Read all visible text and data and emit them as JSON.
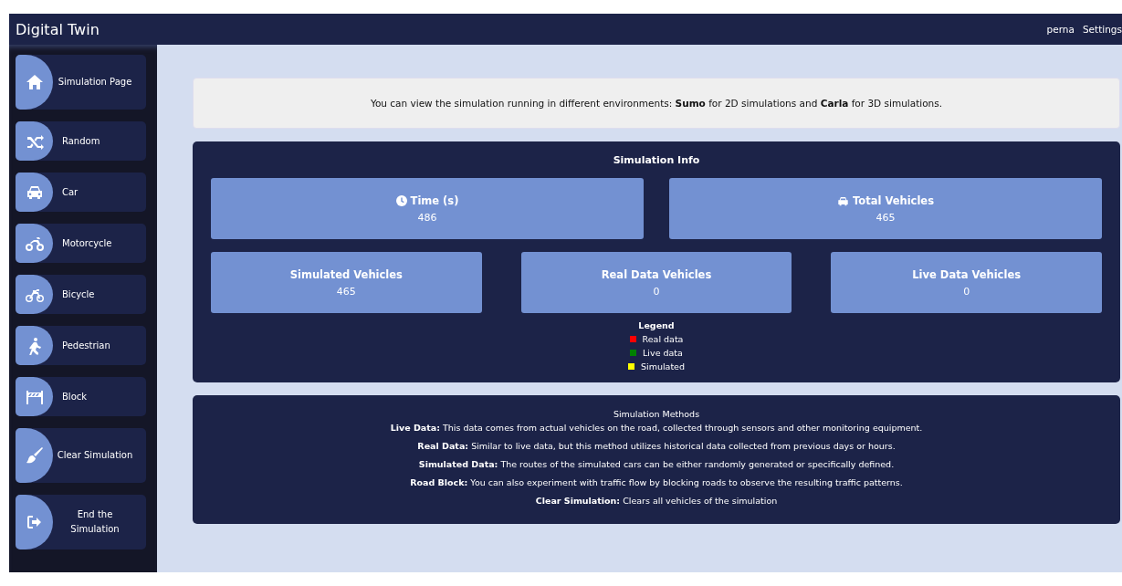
{
  "header": {
    "title": "Digital Twin",
    "user": "perna",
    "settings": "Settings"
  },
  "sidebar": {
    "items": [
      {
        "label": "Simulation Page"
      },
      {
        "label": "Random"
      },
      {
        "label": "Car"
      },
      {
        "label": "Motorcycle"
      },
      {
        "label": "Bicycle"
      },
      {
        "label": "Pedestrian"
      },
      {
        "label": "Block"
      },
      {
        "label": "Clear Simulation"
      },
      {
        "label": "End the Simulation"
      }
    ]
  },
  "banner": "You can view the simulation running in different environments: **Sumo** for 2D simulations and **Carla** for 3D simulations.",
  "simulation_info": {
    "title": "Simulation Info",
    "top_stats": [
      {
        "label": "Time (s)",
        "value": "486"
      },
      {
        "label": "Total Vehicles",
        "value": "465"
      }
    ],
    "bottom_stats": [
      {
        "label": "Simulated Vehicles",
        "value": "465"
      },
      {
        "label": "Real Data Vehicles",
        "value": "0"
      },
      {
        "label": "Live Data Vehicles",
        "value": "0"
      }
    ],
    "legend": {
      "title": "Legend",
      "items": [
        {
          "label": "Real data",
          "color": "#ff0000"
        },
        {
          "label": "Live data",
          "color": "#008000"
        },
        {
          "label": "Simulated",
          "color": "#ffff00"
        }
      ]
    }
  },
  "simulation_methods": {
    "title": "Simulation Methods",
    "lines": [
      "**Live Data:** This data comes from actual vehicles on the road, collected through sensors and other monitoring equipment.",
      "**Real Data:** Similar to live data, but this method utilizes historical data collected from previous days or hours.",
      "**Simulated Data:** The routes of the simulated cars can be either randomly generated or specifically defined.",
      "**Road Block:** You can also experiment with traffic flow by blocking roads to observe the resulting traffic patterns.",
      "**Clear Simulation:** Clears all vehicles of the simulation"
    ]
  }
}
